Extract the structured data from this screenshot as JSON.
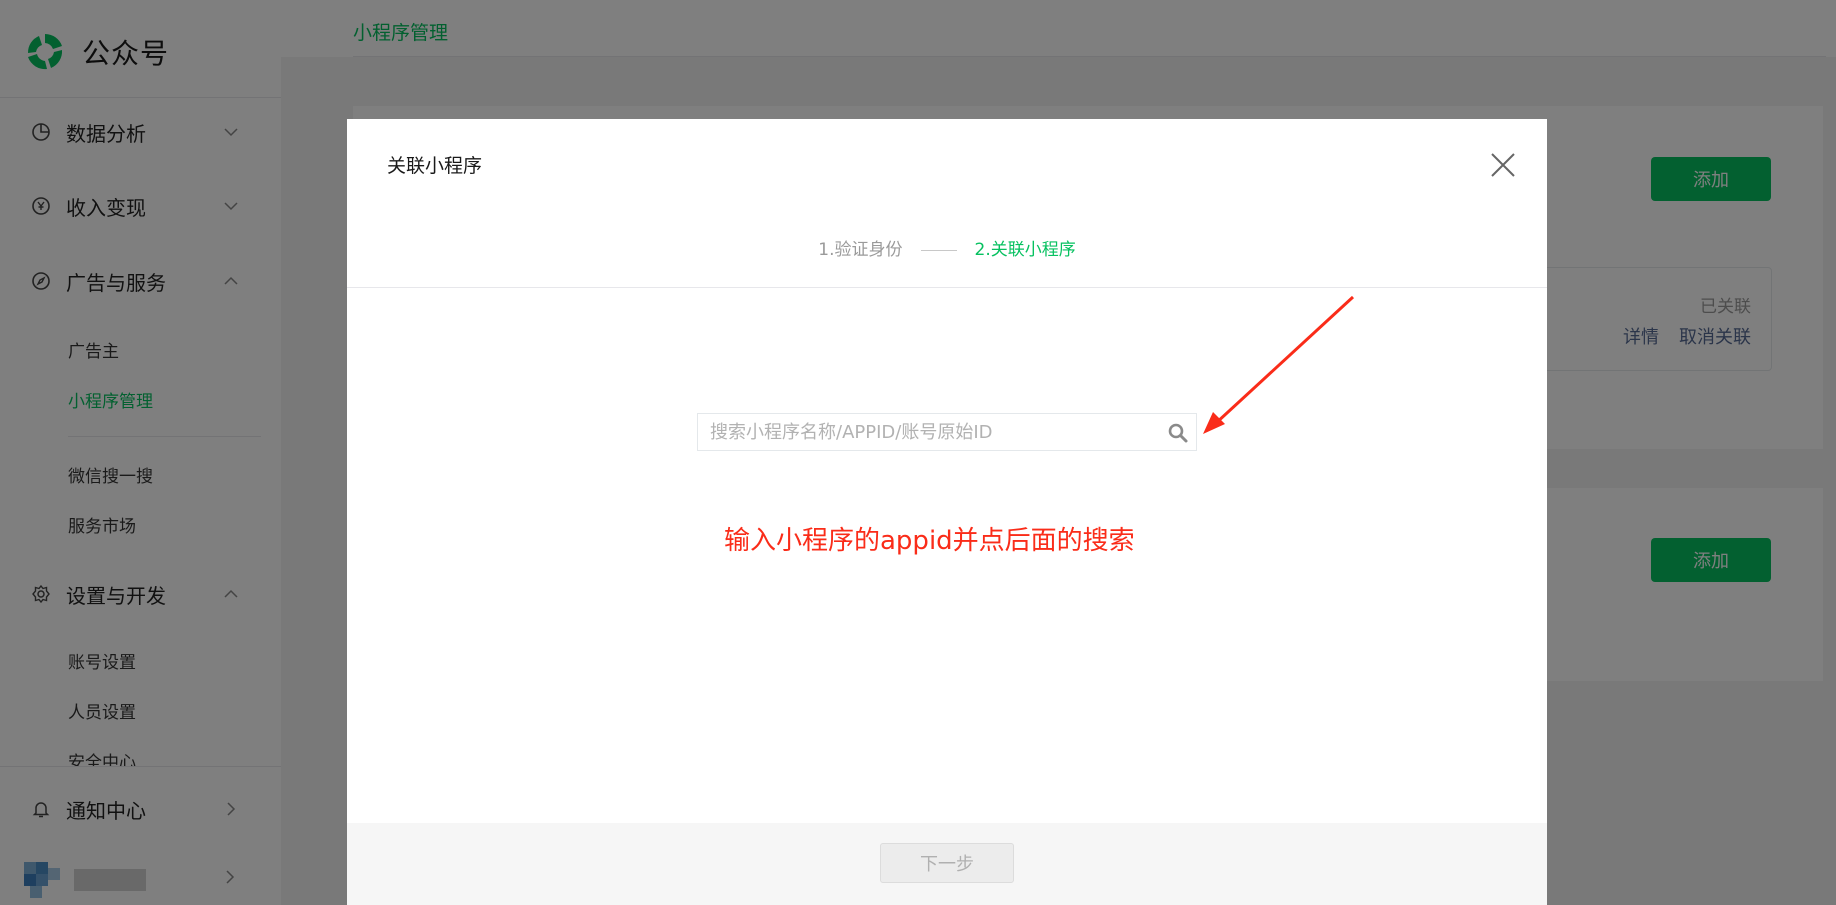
{
  "app": {
    "name": "公众号",
    "logo_icon": "wechat-official-logo-icon"
  },
  "sidebar": {
    "groups": [
      {
        "label": "数据分析",
        "icon": "pie-chart-icon",
        "chevron": "chevron-down-icon"
      },
      {
        "label": "收入变现",
        "icon": "yen-coin-icon",
        "chevron": "chevron-down-icon"
      },
      {
        "label": "广告与服务",
        "icon": "compass-icon",
        "chevron": "chevron-up-icon"
      },
      {
        "label": "设置与开发",
        "icon": "gear-icon",
        "chevron": "chevron-up-icon"
      },
      {
        "label": "通知中心",
        "icon": "bell-icon",
        "chevron": "chevron-right-icon"
      }
    ],
    "ads_items": [
      "广告主",
      "小程序管理",
      "微信搜一搜",
      "服务市场"
    ],
    "settings_items": [
      "账号设置",
      "人员设置",
      "安全中心"
    ],
    "active_item": "小程序管理"
  },
  "main": {
    "tab": "小程序管理",
    "add_button": "添加",
    "linked": {
      "status": "已关联",
      "detail": "详情",
      "unlink": "取消关联"
    }
  },
  "modal": {
    "title": "关联小程序",
    "steps": [
      "1.验证身份",
      "2.关联小程序"
    ],
    "active_step": 2,
    "search": {
      "placeholder": "搜索小程序名称/APPID/账号原始ID",
      "value": ""
    },
    "annotation": "输入小程序的appid并点后面的搜索",
    "next_button": "下一步",
    "next_enabled": false
  },
  "colors": {
    "brand": "#07c160",
    "annotation": "#fa2c19",
    "link": "#576b95"
  }
}
